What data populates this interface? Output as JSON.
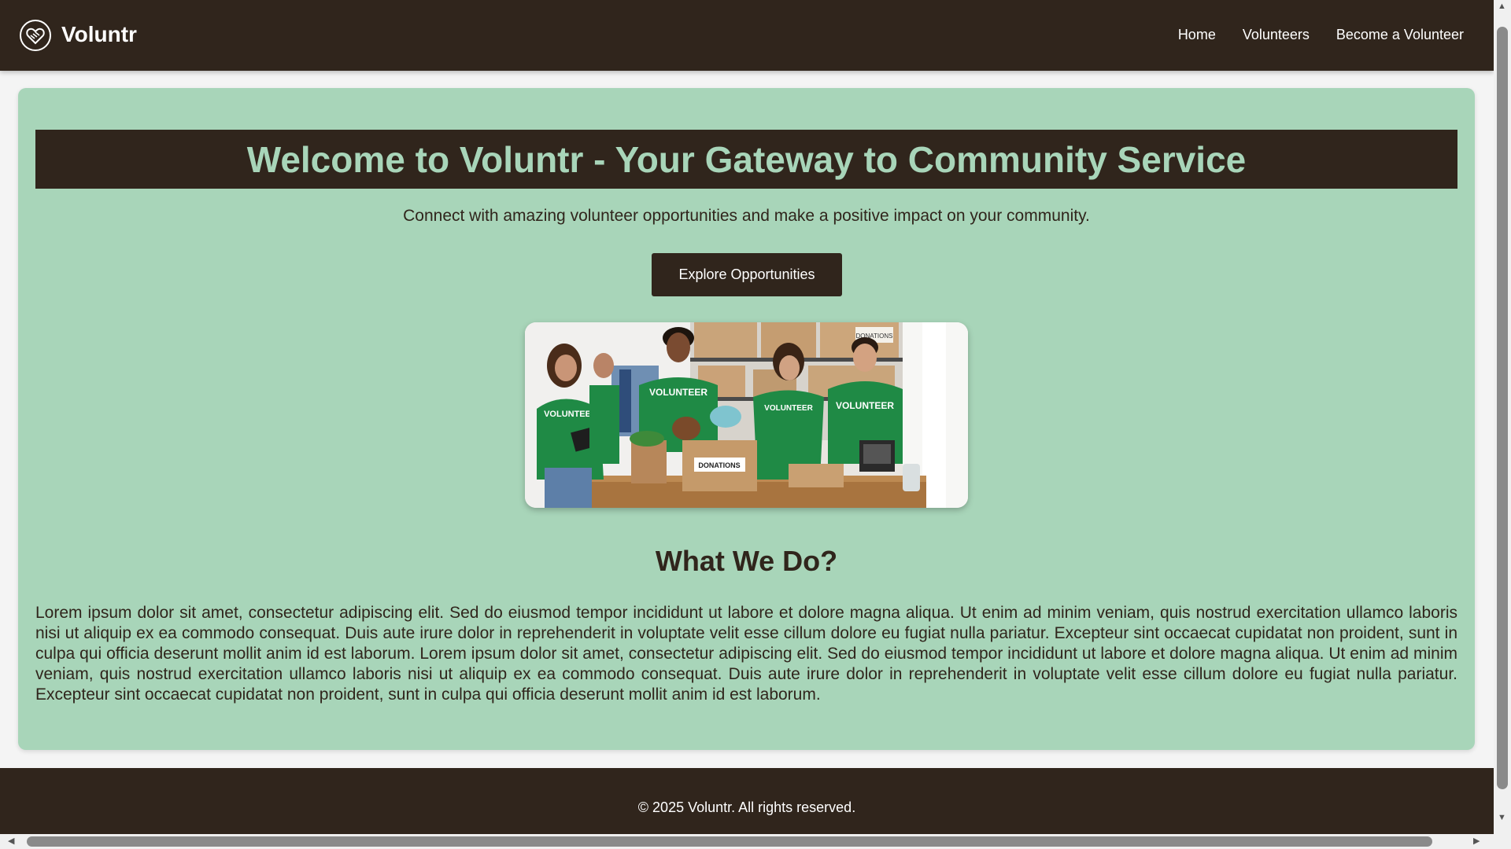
{
  "header": {
    "brand": "Voluntr",
    "nav": [
      {
        "label": "Home"
      },
      {
        "label": "Volunteers"
      },
      {
        "label": "Become a Volunteer"
      }
    ]
  },
  "hero": {
    "title": "Welcome to Voluntr - Your Gateway to Community Service",
    "subtitle": "Connect with amazing volunteer opportunities and make a positive impact on your community.",
    "cta_label": "Explore Opportunities"
  },
  "about": {
    "title": "What We Do?",
    "body": "Lorem ipsum dolor sit amet, consectetur adipiscing elit. Sed do eiusmod tempor incididunt ut labore et dolore magna aliqua. Ut enim ad minim veniam, quis nostrud exercitation ullamco laboris nisi ut aliquip ex ea commodo consequat. Duis aute irure dolor in reprehenderit in voluptate velit esse cillum dolore eu fugiat nulla pariatur. Excepteur sint occaecat cupidatat non proident, sunt in culpa qui officia deserunt mollit anim id est laborum. Lorem ipsum dolor sit amet, consectetur adipiscing elit. Sed do eiusmod tempor incididunt ut labore et dolore magna aliqua. Ut enim ad minim veniam, quis nostrud exercitation ullamco laboris nisi ut aliquip ex ea commodo consequat. Duis aute irure dolor in reprehenderit in voluptate velit esse cillum dolore eu fugiat nulla pariatur. Excepteur sint occaecat cupidatat non proident, sunt in culpa qui officia deserunt mollit anim id est laborum."
  },
  "photo": {
    "shirt_text": "VOLUNTEER",
    "box_text": "DONATIONS"
  },
  "footer": {
    "copyright": "© 2025 Voluntr. All rights reserved."
  },
  "colors": {
    "dark_brown": "#30251c",
    "mint_green": "#a8d5b9",
    "text_white": "#ffffff"
  },
  "icons": {
    "logo": "handshake-heart-icon",
    "scroll_up": "triangle-up",
    "scroll_down": "triangle-down",
    "scroll_left": "triangle-left",
    "scroll_right": "triangle-right"
  }
}
